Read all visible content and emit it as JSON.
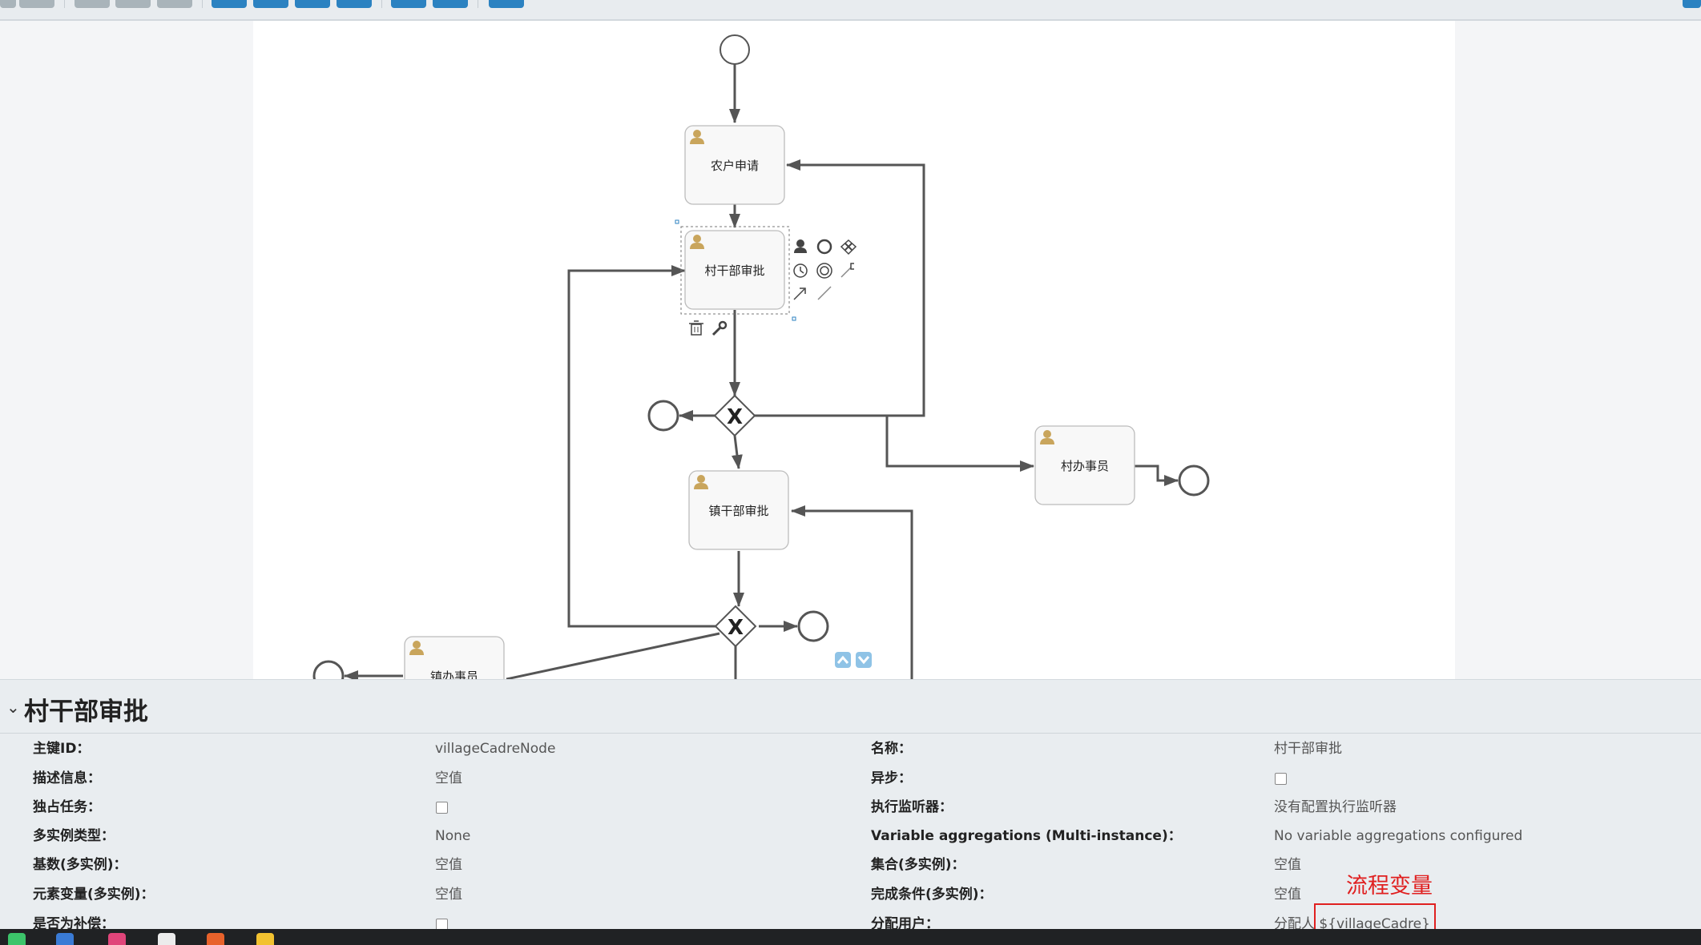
{
  "diagram": {
    "tasks": {
      "farmer_apply": "农户申请",
      "village_cadre_approve": "村干部审批",
      "village_clerk": "村办事员",
      "town_cadre_approve": "镇干部审批",
      "town_clerk": "镇办事员"
    },
    "gateway_symbol": "X"
  },
  "panel": {
    "title": "村干部审批",
    "rows": [
      {
        "left_label": "主键ID：",
        "left_value": "villageCadreNode",
        "right_label": "名称：",
        "right_value": "村干部审批"
      },
      {
        "left_label": "描述信息：",
        "left_value": "空值",
        "right_label": "异步：",
        "right_value": ""
      },
      {
        "left_label": "独占任务：",
        "left_value": "",
        "right_label": "执行监听器：",
        "right_value": "没有配置执行监听器"
      },
      {
        "left_label": "多实例类型：",
        "left_value": "None",
        "right_label": "Variable aggregations (Multi-instance)：",
        "right_value": "No variable aggregations configured"
      },
      {
        "left_label": "基数(多实例)：",
        "left_value": "空值",
        "right_label": "集合(多实例)：",
        "right_value": "空值"
      },
      {
        "left_label": "元素变量(多实例)：",
        "left_value": "空值",
        "right_label": "完成条件(多实例)：",
        "right_value": "空值"
      },
      {
        "left_label": "是否为补偿：",
        "left_value": "",
        "right_label": "分配用户：",
        "right_value": "分配人 ${villageCadre}"
      }
    ],
    "annotation": "流程变量"
  },
  "colors": {
    "accent": "#2b82c1",
    "annotation": "#e02020",
    "user_icon": "#c9a55c"
  }
}
